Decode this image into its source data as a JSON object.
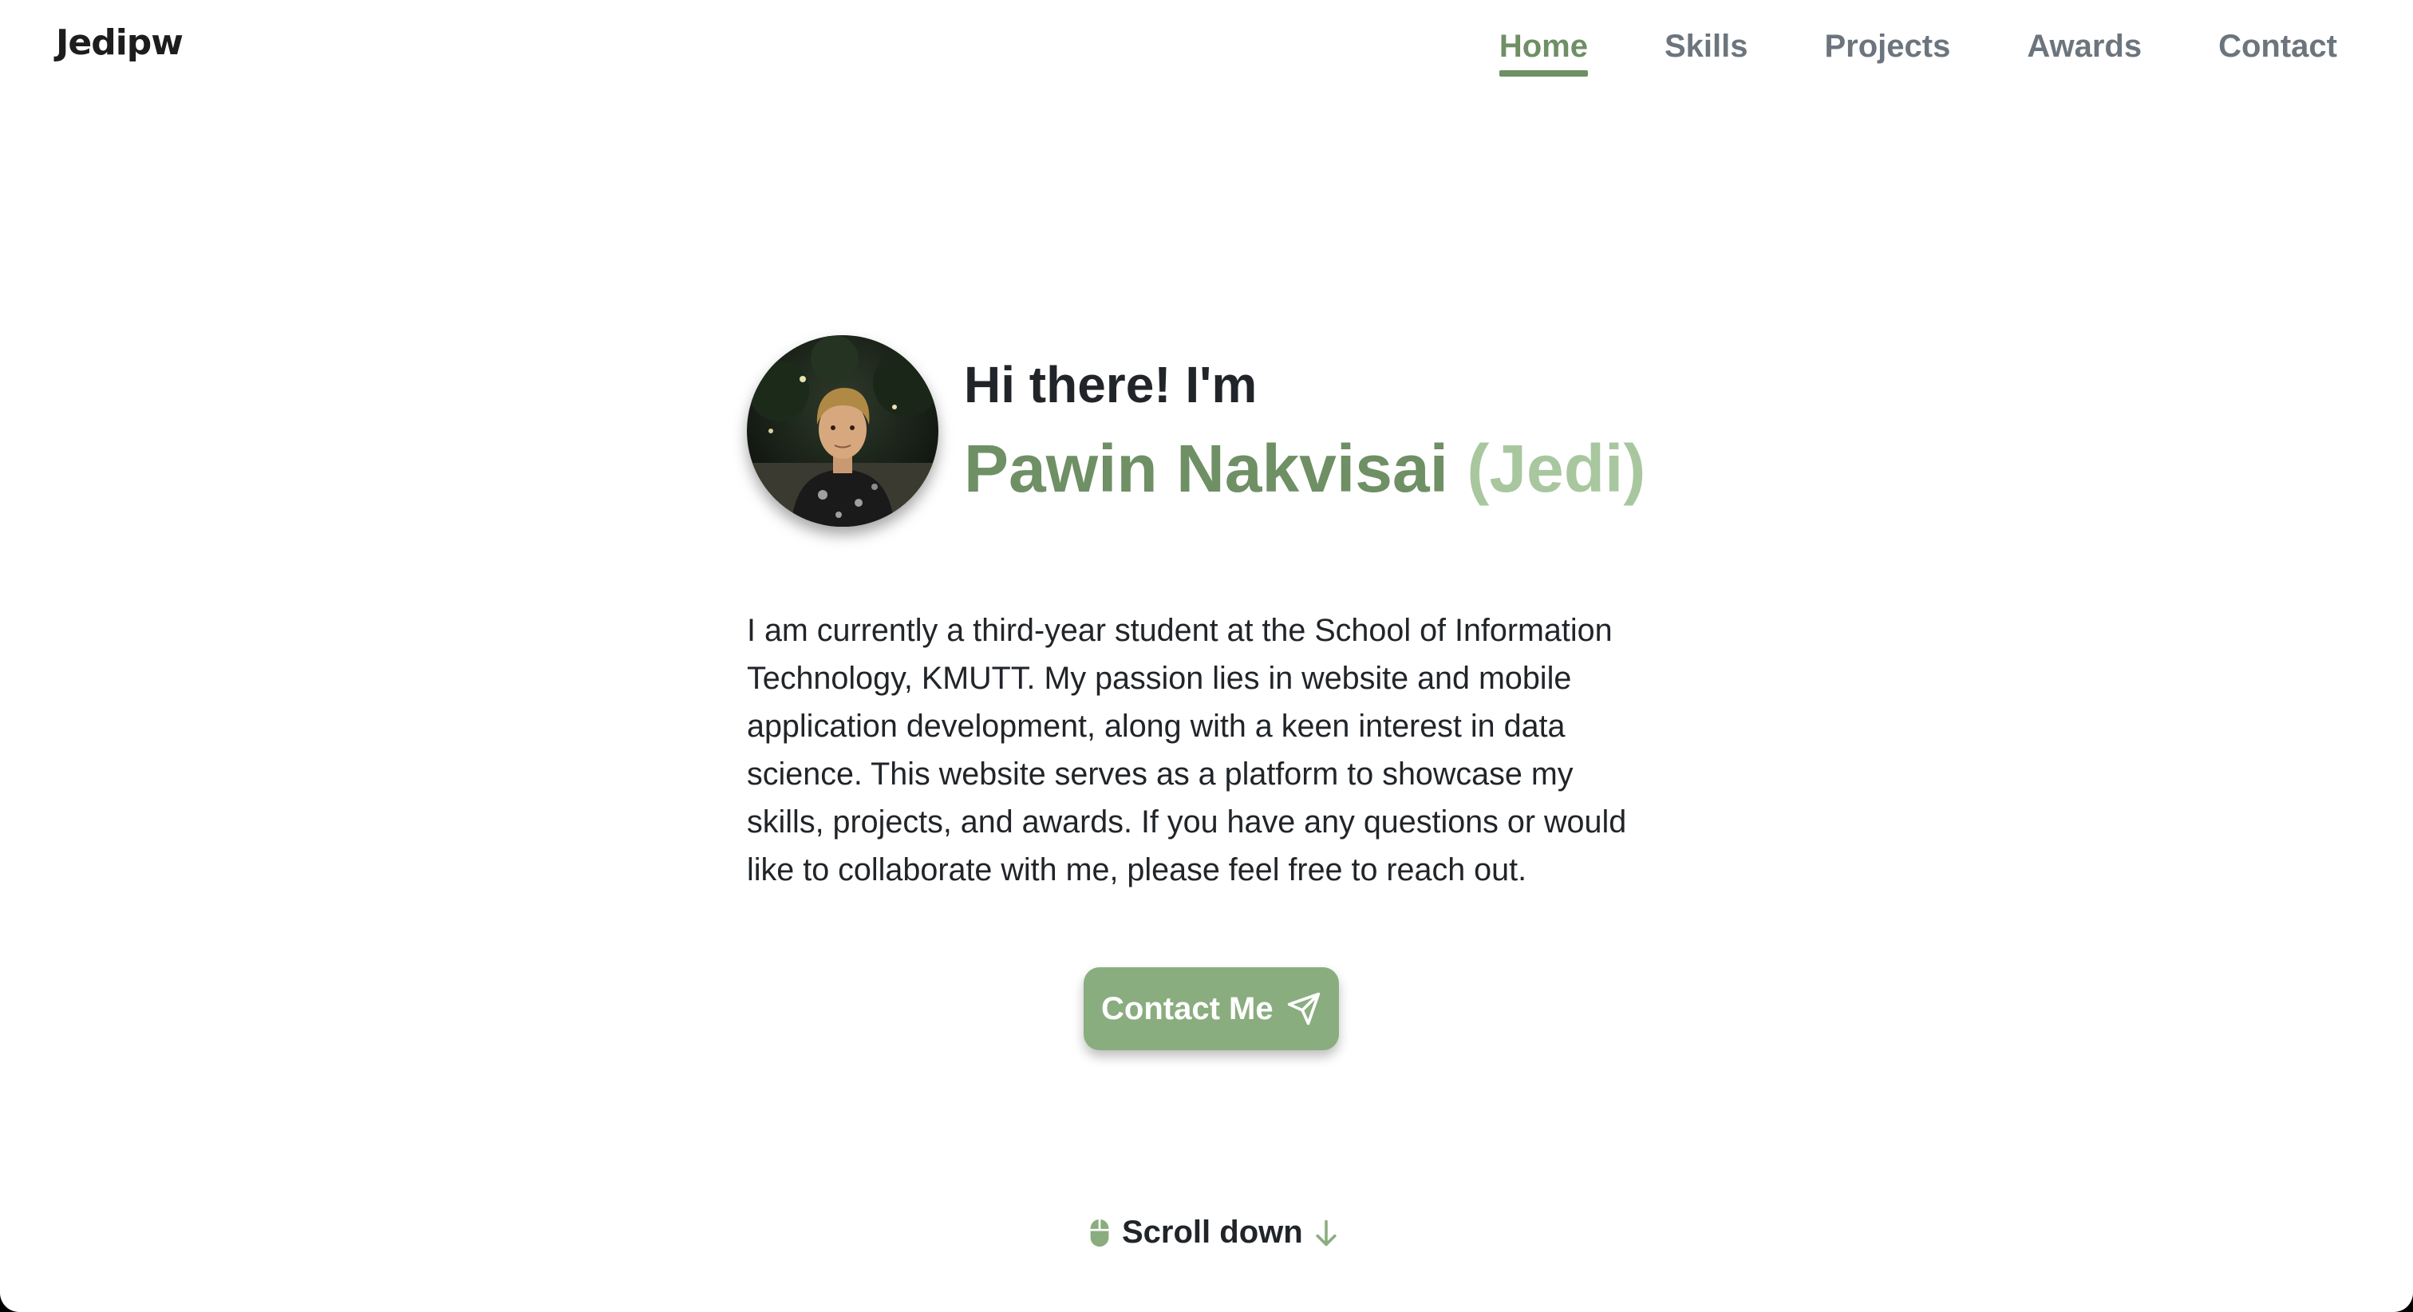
{
  "header": {
    "logo": "Jedipw",
    "nav": [
      {
        "label": "Home",
        "active": true
      },
      {
        "label": "Skills",
        "active": false
      },
      {
        "label": "Projects",
        "active": false
      },
      {
        "label": "Awards",
        "active": false
      },
      {
        "label": "Contact",
        "active": false
      }
    ]
  },
  "hero": {
    "avatar_icon": "profile-photo",
    "greeting": "Hi there! I'm",
    "name": "Pawin Nakvisai",
    "nickname": "(Jedi)",
    "bio": "I am currently a third-year student at the School of Information Technology, KMUTT. My passion lies in website and mobile application development, along with a keen interest in data science. This website serves as a platform to showcase my skills, projects, and awards. If you have any questions or would like to collaborate with me, please feel free to reach out.",
    "cta_label": "Contact Me",
    "cta_icon": "send-icon",
    "scroll_label": "Scroll down",
    "scroll_icons": [
      "mouse-icon",
      "arrow-down-icon"
    ]
  },
  "colors": {
    "accent": "#6f8f65",
    "accent_light": "#a9c79f",
    "button": "#8aad7f",
    "text": "#212529",
    "nav_inactive": "#6c757d"
  }
}
